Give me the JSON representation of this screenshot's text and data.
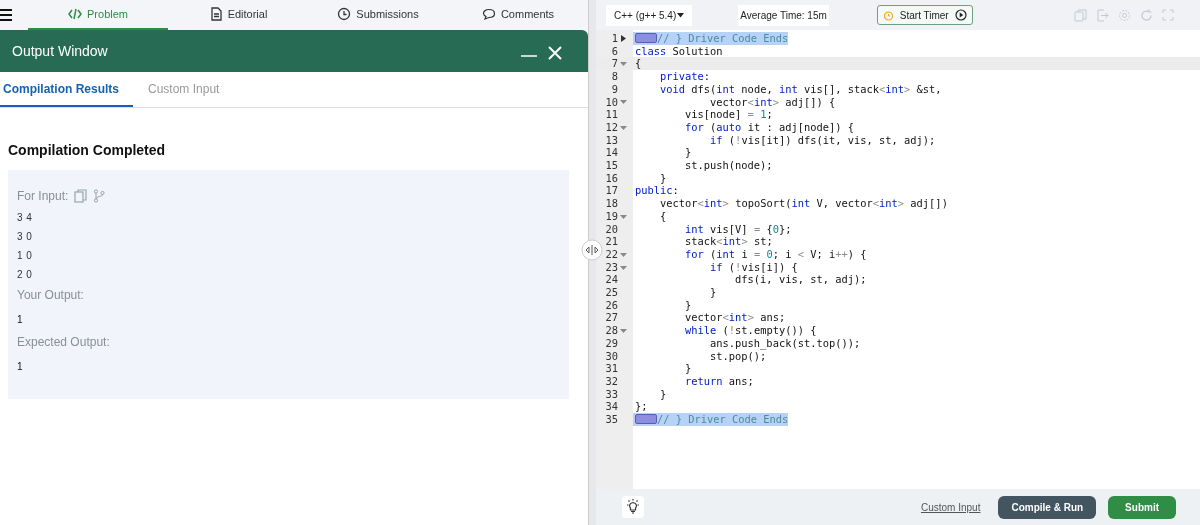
{
  "nav_tabs": [
    {
      "label": "Problem",
      "selected": true
    },
    {
      "label": "Editorial",
      "selected": false
    },
    {
      "label": "Submissions",
      "selected": false
    },
    {
      "label": "Comments",
      "selected": false
    }
  ],
  "output_window": {
    "title": "Output Window",
    "tabs": [
      {
        "label": "Compilation Results",
        "selected": true
      },
      {
        "label": "Custom Input",
        "selected": false
      }
    ],
    "status": "Compilation Completed",
    "input_label": "For Input:",
    "input_lines": [
      "3 4",
      "3 0",
      "1 0",
      "2 0"
    ],
    "your_output_label": "Your Output:",
    "your_output": "1",
    "expected_output_label": "Expected Output:",
    "expected_output": "1"
  },
  "editor": {
    "language": "C++ (g++ 5.4)",
    "average_time": "Average Time: 15m",
    "timer_button": "Start Timer",
    "lines": [
      {
        "number": "1",
        "collapsed": true,
        "selected": true,
        "active": false,
        "tokens": [
          {
            "kind": "marker"
          },
          {
            "kind": "comment",
            "text": "// } Driver Code Ends"
          }
        ]
      },
      {
        "number": "6",
        "selected": false,
        "active": false,
        "tokens": [
          {
            "kind": "kw",
            "text": "class"
          },
          {
            "kind": "plain",
            "text": " Solution"
          }
        ]
      },
      {
        "number": "7",
        "collapsed": false,
        "selected": false,
        "active": true,
        "tokens": [
          {
            "kind": "plain",
            "text": "{"
          }
        ]
      },
      {
        "number": "8",
        "selected": false,
        "active": false,
        "tokens": [
          {
            "kind": "kw",
            "text": "    private"
          },
          {
            "kind": "plain",
            "text": ":"
          }
        ]
      },
      {
        "number": "9",
        "selected": false,
        "active": false,
        "tokens": [
          {
            "kind": "kw",
            "text": "    void"
          },
          {
            "kind": "plain",
            "text": " dfs("
          },
          {
            "kind": "kw",
            "text": "int"
          },
          {
            "kind": "plain",
            "text": " node, "
          },
          {
            "kind": "kw",
            "text": "int"
          },
          {
            "kind": "plain",
            "text": " vis[], stack"
          },
          {
            "kind": "op",
            "text": "<"
          },
          {
            "kind": "kw",
            "text": "int"
          },
          {
            "kind": "op",
            "text": ">"
          },
          {
            "kind": "plain",
            "text": " &st,"
          }
        ]
      },
      {
        "number": "10",
        "collapsed": false,
        "selected": false,
        "active": false,
        "tokens": [
          {
            "kind": "plain",
            "text": "            vector"
          },
          {
            "kind": "op",
            "text": "<"
          },
          {
            "kind": "kw",
            "text": "int"
          },
          {
            "kind": "op",
            "text": ">"
          },
          {
            "kind": "plain",
            "text": " adj[]) {"
          }
        ]
      },
      {
        "number": "11",
        "selected": false,
        "active": false,
        "tokens": [
          {
            "kind": "plain",
            "text": "        vis[node] "
          },
          {
            "kind": "op",
            "text": "="
          },
          {
            "kind": "num",
            "text": " 1"
          },
          {
            "kind": "plain",
            "text": ";"
          }
        ]
      },
      {
        "number": "12",
        "collapsed": false,
        "selected": false,
        "active": false,
        "tokens": [
          {
            "kind": "kw",
            "text": "        for"
          },
          {
            "kind": "plain",
            "text": " ("
          },
          {
            "kind": "kw",
            "text": "auto"
          },
          {
            "kind": "plain",
            "text": " it : adj[node]) {"
          }
        ]
      },
      {
        "number": "13",
        "selected": false,
        "active": false,
        "tokens": [
          {
            "kind": "kw",
            "text": "            if"
          },
          {
            "kind": "plain",
            "text": " ("
          },
          {
            "kind": "op",
            "text": "!"
          },
          {
            "kind": "plain",
            "text": "vis[it]) dfs(it, vis, st, adj);"
          }
        ]
      },
      {
        "number": "14",
        "selected": false,
        "active": false,
        "tokens": [
          {
            "kind": "plain",
            "text": "        }"
          }
        ]
      },
      {
        "number": "15",
        "selected": false,
        "active": false,
        "tokens": [
          {
            "kind": "plain",
            "text": "        st.push(node);"
          }
        ]
      },
      {
        "number": "16",
        "selected": false,
        "active": false,
        "tokens": [
          {
            "kind": "plain",
            "text": "    }"
          }
        ]
      },
      {
        "number": "17",
        "selected": false,
        "active": false,
        "tokens": [
          {
            "kind": "kw",
            "text": "public"
          },
          {
            "kind": "plain",
            "text": ":"
          }
        ]
      },
      {
        "number": "18",
        "selected": false,
        "active": false,
        "tokens": [
          {
            "kind": "plain",
            "text": "    vector"
          },
          {
            "kind": "op",
            "text": "<"
          },
          {
            "kind": "kw",
            "text": "int"
          },
          {
            "kind": "op",
            "text": ">"
          },
          {
            "kind": "plain",
            "text": " topoSort("
          },
          {
            "kind": "kw",
            "text": "int"
          },
          {
            "kind": "plain",
            "text": " V, vector"
          },
          {
            "kind": "op",
            "text": "<"
          },
          {
            "kind": "kw",
            "text": "int"
          },
          {
            "kind": "op",
            "text": ">"
          },
          {
            "kind": "plain",
            "text": " adj[])"
          }
        ]
      },
      {
        "number": "19",
        "collapsed": false,
        "selected": false,
        "active": false,
        "tokens": [
          {
            "kind": "plain",
            "text": "    {"
          }
        ]
      },
      {
        "number": "20",
        "selected": false,
        "active": false,
        "tokens": [
          {
            "kind": "kw",
            "text": "        int"
          },
          {
            "kind": "plain",
            "text": " vis[V] "
          },
          {
            "kind": "op",
            "text": "="
          },
          {
            "kind": "plain",
            "text": " {"
          },
          {
            "kind": "num",
            "text": "0"
          },
          {
            "kind": "plain",
            "text": "};"
          }
        ]
      },
      {
        "number": "21",
        "selected": false,
        "active": false,
        "tokens": [
          {
            "kind": "plain",
            "text": "        stack"
          },
          {
            "kind": "op",
            "text": "<"
          },
          {
            "kind": "kw",
            "text": "int"
          },
          {
            "kind": "op",
            "text": ">"
          },
          {
            "kind": "plain",
            "text": " st;"
          }
        ]
      },
      {
        "number": "22",
        "collapsed": false,
        "selected": false,
        "active": false,
        "tokens": [
          {
            "kind": "kw",
            "text": "        for"
          },
          {
            "kind": "plain",
            "text": " ("
          },
          {
            "kind": "kw",
            "text": "int"
          },
          {
            "kind": "plain",
            "text": " i "
          },
          {
            "kind": "op",
            "text": "="
          },
          {
            "kind": "num",
            "text": " 0"
          },
          {
            "kind": "plain",
            "text": "; i "
          },
          {
            "kind": "op",
            "text": "<"
          },
          {
            "kind": "plain",
            "text": " V; i"
          },
          {
            "kind": "op",
            "text": "++"
          },
          {
            "kind": "plain",
            "text": ") {"
          }
        ]
      },
      {
        "number": "23",
        "collapsed": false,
        "selected": false,
        "active": false,
        "tokens": [
          {
            "kind": "kw",
            "text": "            if"
          },
          {
            "kind": "plain",
            "text": " ("
          },
          {
            "kind": "op",
            "text": "!"
          },
          {
            "kind": "plain",
            "text": "vis[i]) {"
          }
        ]
      },
      {
        "number": "24",
        "selected": false,
        "active": false,
        "tokens": [
          {
            "kind": "plain",
            "text": "                dfs(i, vis, st, adj);"
          }
        ]
      },
      {
        "number": "25",
        "selected": false,
        "active": false,
        "tokens": [
          {
            "kind": "plain",
            "text": "            }"
          }
        ]
      },
      {
        "number": "26",
        "selected": false,
        "active": false,
        "tokens": [
          {
            "kind": "plain",
            "text": "        }"
          }
        ]
      },
      {
        "number": "27",
        "selected": false,
        "active": false,
        "tokens": [
          {
            "kind": "plain",
            "text": "        vector"
          },
          {
            "kind": "op",
            "text": "<"
          },
          {
            "kind": "kw",
            "text": "int"
          },
          {
            "kind": "op",
            "text": ">"
          },
          {
            "kind": "plain",
            "text": " ans;"
          }
        ]
      },
      {
        "number": "28",
        "collapsed": false,
        "selected": false,
        "active": false,
        "tokens": [
          {
            "kind": "kw",
            "text": "        while"
          },
          {
            "kind": "plain",
            "text": " ("
          },
          {
            "kind": "op",
            "text": "!"
          },
          {
            "kind": "plain",
            "text": "st.empty()) {"
          }
        ]
      },
      {
        "number": "29",
        "selected": false,
        "active": false,
        "tokens": [
          {
            "kind": "plain",
            "text": "            ans.push_back(st.top());"
          }
        ]
      },
      {
        "number": "30",
        "selected": false,
        "active": false,
        "tokens": [
          {
            "kind": "plain",
            "text": "            st.pop();"
          }
        ]
      },
      {
        "number": "31",
        "selected": false,
        "active": false,
        "tokens": [
          {
            "kind": "plain",
            "text": "        }"
          }
        ]
      },
      {
        "number": "32",
        "selected": false,
        "active": false,
        "tokens": [
          {
            "kind": "kw",
            "text": "        return"
          },
          {
            "kind": "plain",
            "text": " ans;"
          }
        ]
      },
      {
        "number": "33",
        "selected": false,
        "active": false,
        "tokens": [
          {
            "kind": "plain",
            "text": "    }"
          }
        ]
      },
      {
        "number": "34",
        "selected": false,
        "active": false,
        "tokens": [
          {
            "kind": "plain",
            "text": "};"
          }
        ]
      },
      {
        "number": "35",
        "selected": true,
        "active": false,
        "tokens": [
          {
            "kind": "marker"
          },
          {
            "kind": "comment",
            "text": "// } Driver Code Ends"
          }
        ]
      }
    ],
    "custom_input_link": "Custom Input",
    "compile_button": "Compile & Run",
    "submit_button": "Submit"
  }
}
